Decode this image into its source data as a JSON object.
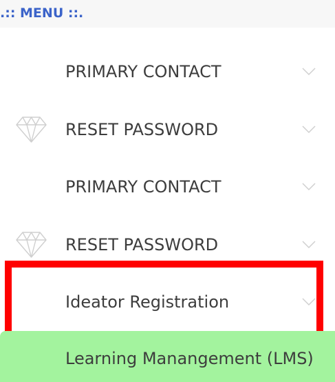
{
  "menu": {
    "header": ".:: MENU ::.",
    "items": [
      {
        "label": "PRIMARY CONTACT",
        "icon": "",
        "chevron": "chevron-down-icon"
      },
      {
        "label": "RESET PASSWORD",
        "icon": "diamond-icon",
        "chevron": "chevron-down-icon"
      },
      {
        "label": "PRIMARY CONTACT",
        "icon": "",
        "chevron": "chevron-down-icon"
      },
      {
        "label": "RESET PASSWORD",
        "icon": "diamond-icon",
        "chevron": "chevron-down-icon"
      },
      {
        "label": "Ideator Registration",
        "icon": "",
        "chevron": "chevron-down-icon"
      }
    ],
    "active_item": {
      "label": "Learning Manangement (LMS)"
    }
  },
  "colors": {
    "header_text": "#3b63c9",
    "highlight_border": "#ff0000",
    "active_background": "#a3f39e",
    "item_text": "#3d3d3d",
    "icon_stroke": "#cfcfcf"
  }
}
